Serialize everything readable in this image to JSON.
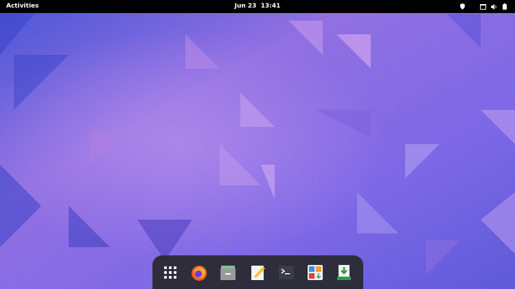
{
  "topbar": {
    "activities": "Activities",
    "date": "Jun 23",
    "time": "13:41",
    "tray_icons": [
      "shield-icon",
      "screen-icon",
      "volume-icon",
      "battery-icon"
    ]
  },
  "dock": {
    "apps": [
      {
        "name": "Show Applications",
        "icon": "app-grid-icon"
      },
      {
        "name": "Firefox",
        "icon": "firefox-icon"
      },
      {
        "name": "Files",
        "icon": "file-cabinet-icon"
      },
      {
        "name": "Text Editor",
        "icon": "text-editor-icon"
      },
      {
        "name": "Terminal",
        "icon": "terminal-icon"
      },
      {
        "name": "Software",
        "icon": "software-icon"
      },
      {
        "name": "Installer",
        "icon": "installer-icon"
      }
    ]
  },
  "colors": {
    "wall_a": "#4a4fd0",
    "wall_b": "#9a6ee0",
    "topbar": "#000000",
    "dock": "#28282c"
  }
}
